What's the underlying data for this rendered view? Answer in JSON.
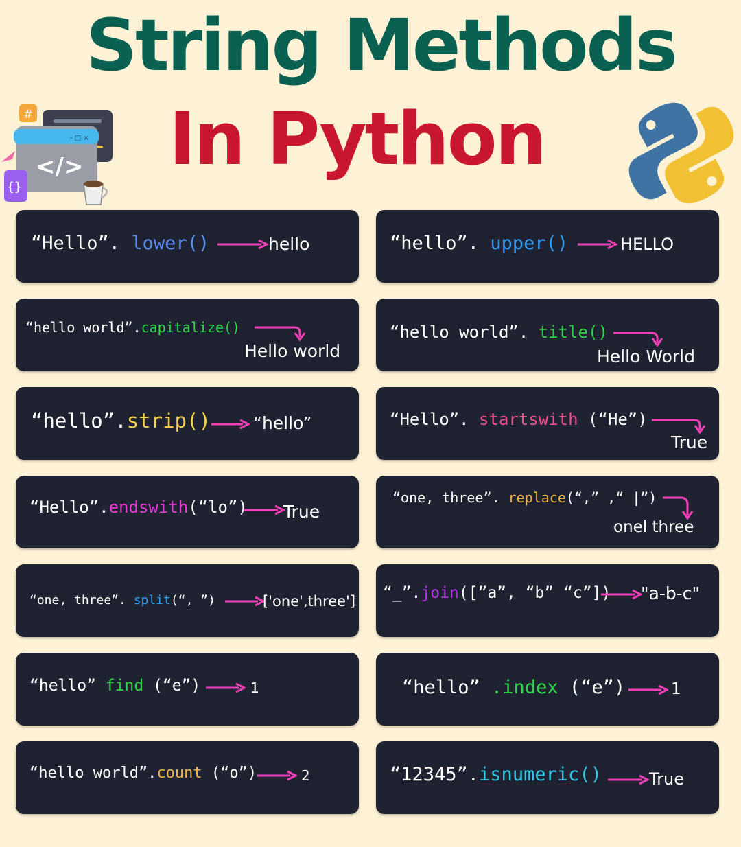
{
  "title": {
    "line1": "String Methods",
    "line2": "In Python"
  },
  "illustration": {
    "hash_badge": "#",
    "code_symbol": "</>",
    "braces_badge": "{}",
    "window_controls": "- □ ×"
  },
  "colors": {
    "background": "#fdf2d6",
    "title_green": "#0a6051",
    "title_red": "#c8172f",
    "card_bg": "#1f2230",
    "arrow": "#f040b8"
  },
  "cards": {
    "lower": {
      "code": "“Hello”. ",
      "method": "lower()",
      "result": "hello"
    },
    "upper": {
      "code": "“hello”. ",
      "method": "upper()",
      "result": "HELLO"
    },
    "capitalize": {
      "code": "“hello world”.",
      "method": "capitalize()",
      "result": "Hello world"
    },
    "title": {
      "code": "“hello world”. ",
      "method": "title()",
      "result": "Hello World"
    },
    "strip": {
      "code": "“hello”.",
      "method": "strip()",
      "result": "“hello”"
    },
    "startswith": {
      "code": "“Hello”. ",
      "method": "startswith",
      "args": " (“He”)",
      "result": "True"
    },
    "endswith": {
      "code": "“Hello”.",
      "method": "endswith",
      "args": "(“lo”)",
      "result": "True"
    },
    "replace": {
      "code": "“one, three”. ",
      "method": "replace",
      "args": "(“,” ,“ |”)",
      "result": "onel three"
    },
    "split": {
      "code": "“one, three”. ",
      "method": "split",
      "args": "(“, ”)",
      "result": "['one',three']"
    },
    "join": {
      "code": "“_”.",
      "method": "join",
      "args": "([”a”, “b” “c”])",
      "result": "\"a-b-c\""
    },
    "find": {
      "code": "“hello” ",
      "method": "find",
      "args": " (“e”)",
      "result": "1"
    },
    "index": {
      "code": "“hello” ",
      "method": ".index",
      "args": " (“e”)",
      "result": "1"
    },
    "count": {
      "code": "“hello world”.",
      "method": "count",
      "args": " (“o”)",
      "result": "2"
    },
    "isnumeric": {
      "code": "“12345”.",
      "method": "isnumeric()",
      "result": "True"
    }
  }
}
